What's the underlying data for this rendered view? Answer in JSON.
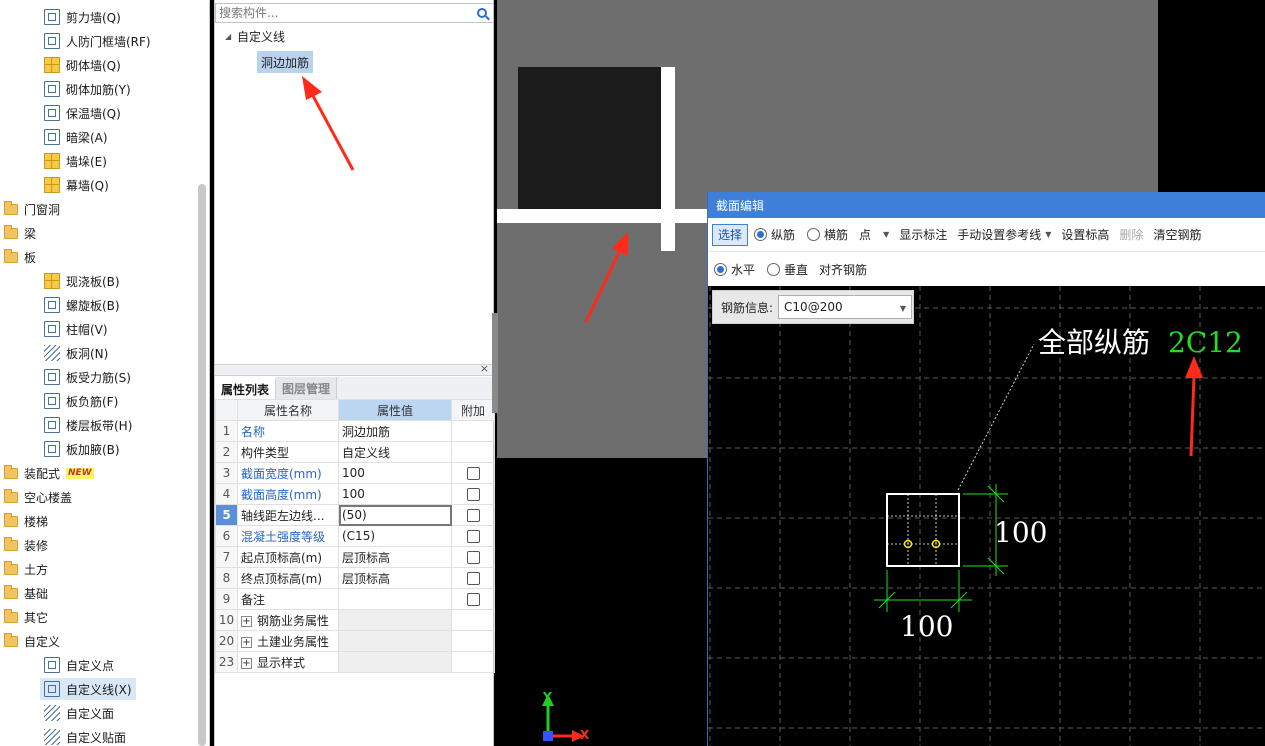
{
  "tree": {
    "items": [
      {
        "label": "剪力墙(Q)",
        "icon": "shear-wall-icon",
        "level": 2
      },
      {
        "label": "人防门框墙(RF)",
        "icon": "civil-defense-door-wall-icon",
        "level": 2
      },
      {
        "label": "砌体墙(Q)",
        "icon": "masonry-wall-icon",
        "level": 2
      },
      {
        "label": "砌体加筋(Y)",
        "icon": "masonry-reinforcement-icon",
        "level": 2
      },
      {
        "label": "保温墙(Q)",
        "icon": "insulation-wall-icon",
        "level": 2
      },
      {
        "label": "暗梁(A)",
        "icon": "hidden-beam-icon",
        "level": 2
      },
      {
        "label": "墙垛(E)",
        "icon": "wall-pier-icon",
        "level": 2
      },
      {
        "label": "幕墙(Q)",
        "icon": "curtain-wall-icon",
        "level": 2
      },
      {
        "label": "门窗洞",
        "icon": "folder-icon",
        "level": 1,
        "expanded": false
      },
      {
        "label": "梁",
        "icon": "folder-icon",
        "level": 1,
        "expanded": false
      },
      {
        "label": "板",
        "icon": "folder-icon",
        "level": 1,
        "expanded": true
      },
      {
        "label": "现浇板(B)",
        "icon": "cast-slab-icon",
        "level": 2
      },
      {
        "label": "螺旋板(B)",
        "icon": "spiral-slab-icon",
        "level": 2
      },
      {
        "label": "柱帽(V)",
        "icon": "column-cap-icon",
        "level": 2
      },
      {
        "label": "板洞(N)",
        "icon": "slab-hole-icon",
        "level": 2
      },
      {
        "label": "板受力筋(S)",
        "icon": "slab-main-rebar-icon",
        "level": 2
      },
      {
        "label": "板负筋(F)",
        "icon": "slab-negative-rebar-icon",
        "level": 2
      },
      {
        "label": "楼层板带(H)",
        "icon": "floor-slab-strip-icon",
        "level": 2
      },
      {
        "label": "板加腋(B)",
        "icon": "slab-haunch-icon",
        "level": 2
      },
      {
        "label": "装配式",
        "icon": "folder-icon",
        "level": 1,
        "expanded": false,
        "badge": "NEW"
      },
      {
        "label": "空心楼盖",
        "icon": "folder-icon",
        "level": 1,
        "expanded": false
      },
      {
        "label": "楼梯",
        "icon": "folder-icon",
        "level": 1,
        "expanded": false
      },
      {
        "label": "装修",
        "icon": "folder-icon",
        "level": 1,
        "expanded": false
      },
      {
        "label": "土方",
        "icon": "folder-icon",
        "level": 1,
        "expanded": false
      },
      {
        "label": "基础",
        "icon": "folder-icon",
        "level": 1,
        "expanded": false
      },
      {
        "label": "其它",
        "icon": "folder-icon",
        "level": 1,
        "expanded": false
      },
      {
        "label": "自定义",
        "icon": "folder-icon",
        "level": 1,
        "expanded": true
      },
      {
        "label": "自定义点",
        "icon": "custom-point-icon",
        "level": 2
      },
      {
        "label": "自定义线(X)",
        "icon": "custom-line-icon",
        "level": 2,
        "selected": true
      },
      {
        "label": "自定义面",
        "icon": "custom-face-icon",
        "level": 2
      },
      {
        "label": "自定义贴面",
        "icon": "custom-veneer-icon",
        "level": 2
      }
    ]
  },
  "component_list": {
    "search_placeholder": "搜索构件...",
    "root_label": "自定义线",
    "child_label": "洞边加筋"
  },
  "properties": {
    "tabs": [
      "属性列表",
      "图层管理"
    ],
    "headers": {
      "name": "属性名称",
      "value": "属性值",
      "extra": "附加"
    },
    "rows": [
      {
        "num": "1",
        "name": "名称",
        "value": "洞边加筋",
        "blue": true,
        "check": false
      },
      {
        "num": "2",
        "name": "构件类型",
        "value": "自定义线",
        "blue": false,
        "check": false
      },
      {
        "num": "3",
        "name": "截面宽度(mm)",
        "value": "100",
        "blue": true,
        "check": true
      },
      {
        "num": "4",
        "name": "截面高度(mm)",
        "value": "100",
        "blue": true,
        "check": true
      },
      {
        "num": "5",
        "name": "轴线距左边线...",
        "value": "(50)",
        "blue": false,
        "check": true,
        "selected": true
      },
      {
        "num": "6",
        "name": "混凝土强度等级",
        "value": "(C15)",
        "blue": true,
        "check": true
      },
      {
        "num": "7",
        "name": "起点顶标高(m)",
        "value": "层顶标高",
        "blue": false,
        "check": true
      },
      {
        "num": "8",
        "name": "终点顶标高(m)",
        "value": "层顶标高",
        "blue": false,
        "check": true
      },
      {
        "num": "9",
        "name": "备注",
        "value": "",
        "blue": false,
        "check": true
      },
      {
        "num": "10",
        "name": "钢筋业务属性",
        "value": "",
        "group": true
      },
      {
        "num": "20",
        "name": "土建业务属性",
        "value": "",
        "group": true
      },
      {
        "num": "23",
        "name": "显示样式",
        "value": "",
        "group": true
      }
    ]
  },
  "dialog": {
    "title": "截面编辑",
    "toolbar1": {
      "select": "选择",
      "longitudinal": "纵筋",
      "transverse": "横筋",
      "point": "点",
      "show_annotation": "显示标注",
      "manual_reference": "手动设置参考线",
      "set_elevation": "设置标高",
      "delete": "删除",
      "clear_rebar": "清空钢筋"
    },
    "toolbar2": {
      "horizontal": "水平",
      "vertical": "垂直",
      "align_rebar": "对齐钢筋"
    },
    "rebar_info_label": "钢筋信息:",
    "rebar_info_value": "C10@200",
    "section": {
      "label_all": "全部纵筋",
      "label_spec": "2C12",
      "dim_height": "100",
      "dim_width": "100"
    }
  },
  "axis": {
    "x_label": "X",
    "y_label": "Y"
  },
  "colors": {
    "title_bar": "#3d7fd9",
    "annotation_arrow": "#ff2a1a",
    "dimension_green": "#22dd22",
    "rebar_spec_green": "#22dd22",
    "canvas_grey": "#6e6e6e"
  }
}
